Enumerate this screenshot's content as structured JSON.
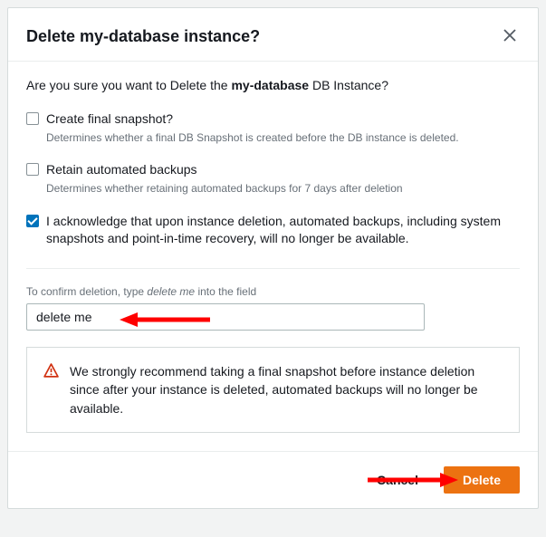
{
  "modal": {
    "title": "Delete my-database instance?",
    "confirm_prefix": "Are you sure you want to Delete the ",
    "confirm_bold": "my-database",
    "confirm_suffix": " DB Instance?",
    "options": [
      {
        "label": "Create final snapshot?",
        "desc": "Determines whether a final DB Snapshot is created before the DB instance is deleted.",
        "checked": false
      },
      {
        "label": "Retain automated backups",
        "desc": "Determines whether retaining automated backups for 7 days after deletion",
        "checked": false
      },
      {
        "label": "I acknowledge that upon instance deletion, automated backups, including system snapshots and point-in-time recovery, will no longer be available.",
        "desc": "",
        "checked": true
      }
    ],
    "confirm_field": {
      "label_prefix": "To confirm deletion, type ",
      "label_italic": "delete me",
      "label_suffix": " into the field",
      "value": "delete me"
    },
    "warning": "We strongly recommend taking a final snapshot before instance deletion since after your instance is deleted, automated backups will no longer be available.",
    "buttons": {
      "cancel": "Cancel",
      "delete": "Delete"
    }
  }
}
